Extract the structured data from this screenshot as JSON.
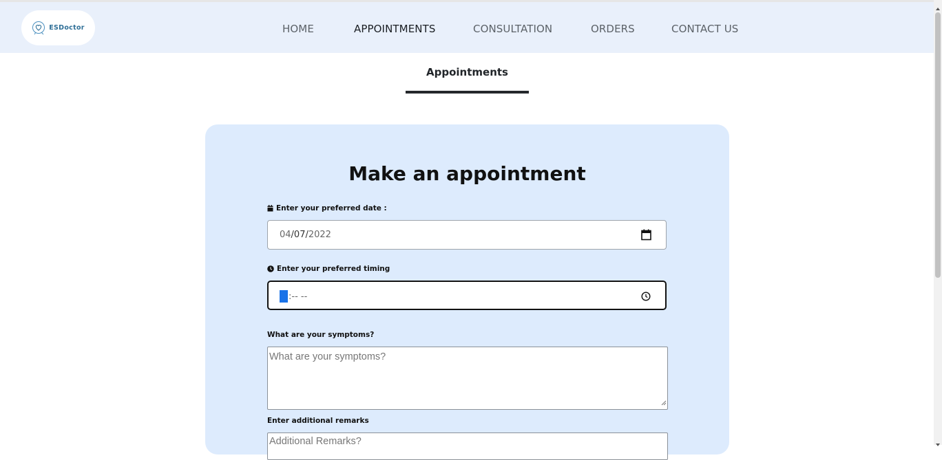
{
  "header": {
    "brand": "ESDoctor",
    "nav": [
      {
        "label": "HOME",
        "active": false
      },
      {
        "label": "APPOINTMENTS",
        "active": true
      },
      {
        "label": "CONSULTATION",
        "active": false
      },
      {
        "label": "ORDERS",
        "active": false
      },
      {
        "label": "CONTACT US",
        "active": false
      }
    ]
  },
  "page": {
    "heading": "Appointments"
  },
  "form": {
    "title": "Make an appointment",
    "date_label": "Enter your preferred date :",
    "date_value_month": "04",
    "date_value_rest": "/07/",
    "date_value_year": "2022",
    "time_label": "Enter your preferred timing",
    "time_value": ":-- --",
    "symptoms_label": "What are your symptoms?",
    "symptoms_placeholder": "What are your symptoms?",
    "remarks_label": "Enter additional remarks",
    "remarks_placeholder": "Additional Remarks?"
  },
  "icons": {
    "date": "calendar-icon",
    "time": "clock-icon"
  },
  "colors": {
    "navbar_bg": "#e9f0fb",
    "card_bg": "#ddebfd",
    "brand": "#2f6f97",
    "highlight": "#1a73e8"
  }
}
